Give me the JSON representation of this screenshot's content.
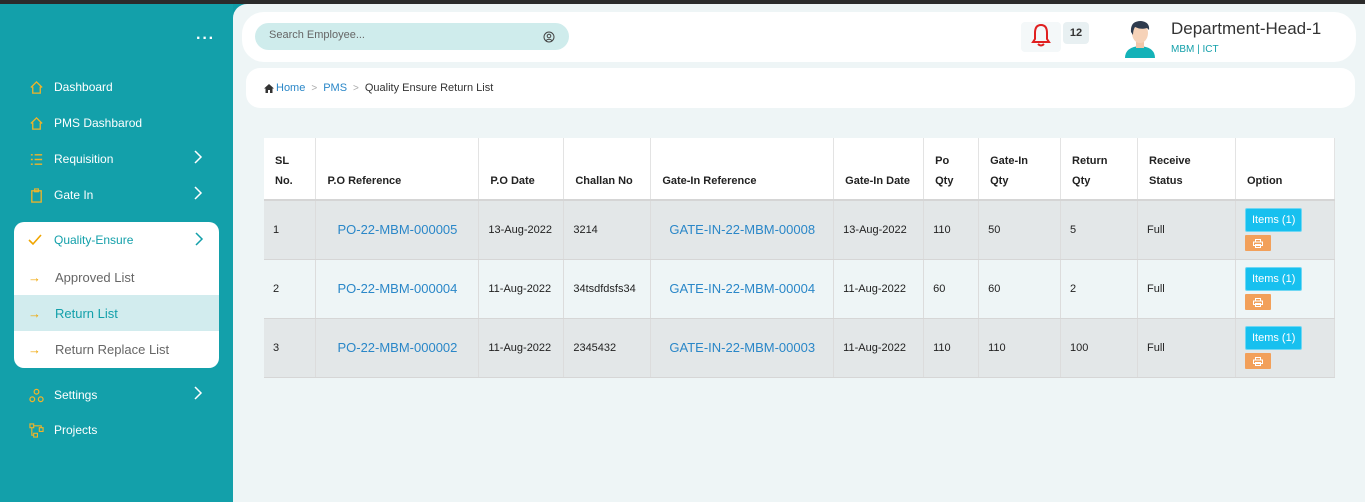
{
  "sidebar": {
    "items": [
      {
        "label": "Dashboard",
        "icon": "home-icon"
      },
      {
        "label": "PMS Dashbarod",
        "icon": "home-icon"
      },
      {
        "label": "Requisition",
        "icon": "list-icon"
      },
      {
        "label": "Gate In",
        "icon": "clipboard-icon"
      },
      {
        "label": "Settings",
        "icon": "settings-icon"
      },
      {
        "label": "Projects",
        "icon": "projects-icon"
      }
    ],
    "quality": {
      "label": "Quality-Ensure",
      "items": [
        "Approved List",
        "Return List",
        "Return Replace List"
      ],
      "active": "Return List"
    }
  },
  "header": {
    "search_placeholder": "Search Employee...",
    "notification_count": "12",
    "user_name": "Department-Head-1",
    "user_dept": "MBM  | ICT"
  },
  "breadcrumb": {
    "home": "Home",
    "pms": "PMS",
    "current": "Quality Ensure Return List"
  },
  "table": {
    "headers": [
      "SL No.",
      "P.O Reference",
      "P.O Date",
      "Challan No",
      "Gate-In Reference",
      "Gate-In Date",
      "Po Qty",
      "Gate-In Qty",
      "Return Qty",
      "Receive Status",
      "Option"
    ],
    "rows": [
      [
        "1",
        "PO-22-MBM-000005",
        "13-Aug-2022",
        "3214",
        "GATE-IN-22-MBM-00008",
        "13-Aug-2022",
        "110",
        "50",
        "5",
        "Full"
      ],
      [
        "2",
        "PO-22-MBM-000004",
        "11-Aug-2022",
        "34tsdfdsfs34",
        "GATE-IN-22-MBM-00004",
        "11-Aug-2022",
        "60",
        "60",
        "2",
        "Full"
      ],
      [
        "3",
        "PO-22-MBM-000002",
        "11-Aug-2022",
        "2345432",
        "GATE-IN-22-MBM-00003",
        "11-Aug-2022",
        "110",
        "110",
        "100",
        "Full"
      ]
    ],
    "items_button": "Items (1)"
  },
  "colors": {
    "sidebar": "#13a0aa",
    "accent": "#f0a500",
    "link": "#2a87c8",
    "items_button": "#17c0ef",
    "print_button": "#f2a05a"
  }
}
